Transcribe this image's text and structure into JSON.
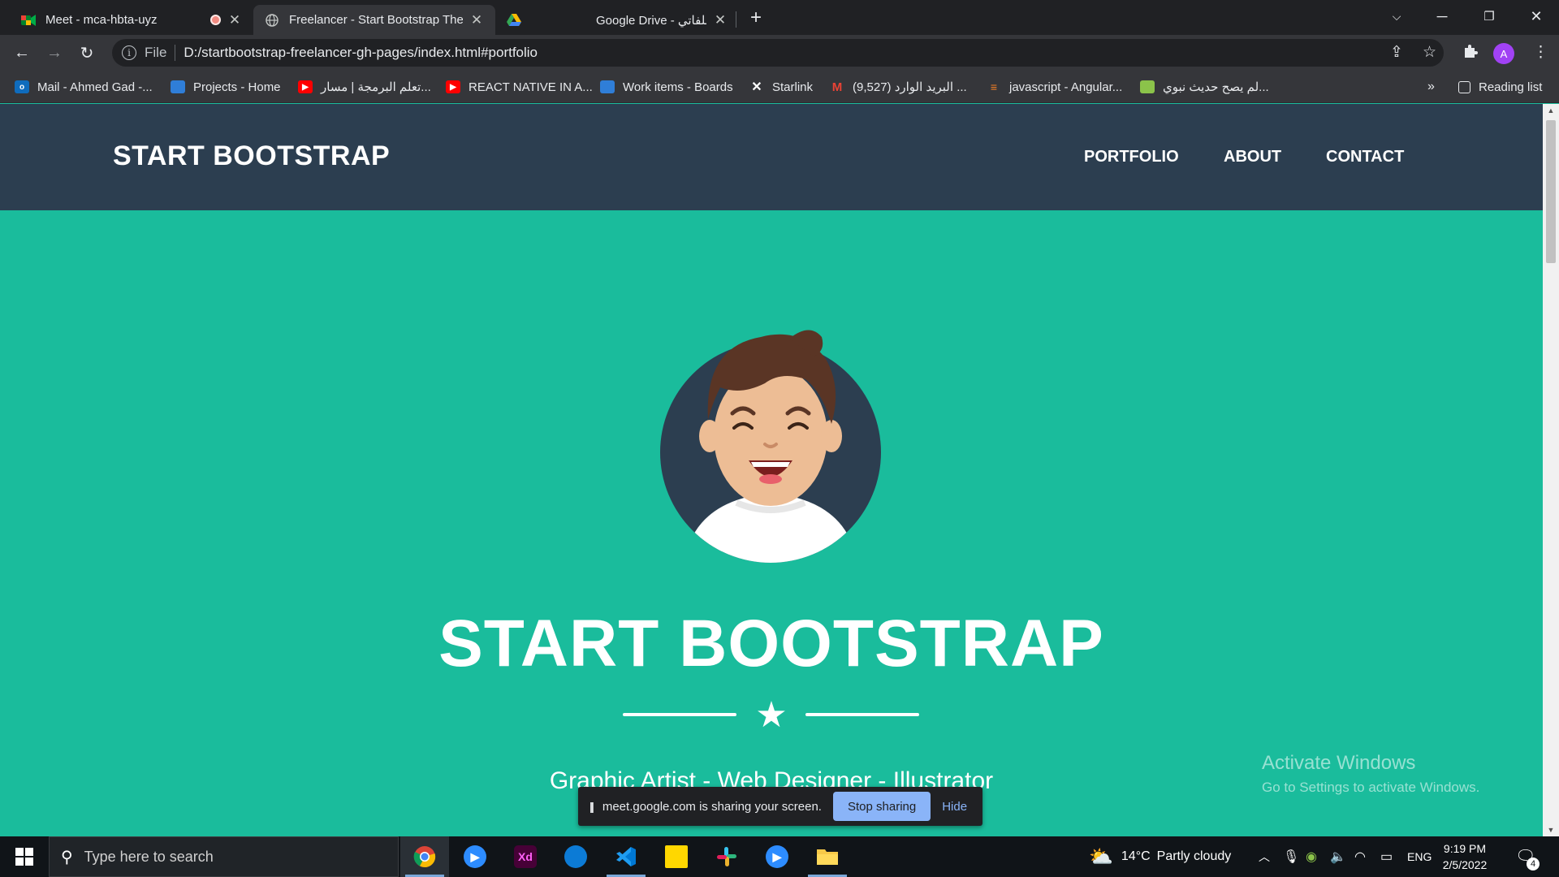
{
  "browser": {
    "tabs": [
      {
        "title": "Meet - mca-hbta-uyz",
        "favicon": "google-meet-icon"
      },
      {
        "title": "Freelancer - Start Bootstrap Theme",
        "favicon": "globe-icon"
      },
      {
        "title": "Google Drive - ملفاتي",
        "favicon": "google-drive-icon"
      }
    ],
    "address": {
      "scheme_label": "File",
      "url": "D:/startbootstrap-freelancer-gh-pages/index.html#portfolio"
    },
    "profile_initial": "A",
    "bookmarks": [
      {
        "label": "Mail - Ahmed Gad -...",
        "icon": "outlook-icon",
        "color": "#0f6cbd"
      },
      {
        "label": "Projects - Home",
        "icon": "azure-devops-icon",
        "color": "#2f7ed8"
      },
      {
        "label": "تعلم البرمجة | مسار...",
        "icon": "youtube-icon",
        "color": "#ff0000"
      },
      {
        "label": "REACT NATIVE IN A...",
        "icon": "youtube-icon",
        "color": "#ff0000"
      },
      {
        "label": "Work items - Boards",
        "icon": "azure-devops-icon",
        "color": "#2f7ed8"
      },
      {
        "label": "Starlink",
        "icon": "starlink-icon",
        "color": "#ffffff"
      },
      {
        "label": "(9,527) البريد الوارد ...",
        "icon": "gmail-icon",
        "color": "#ea4335"
      },
      {
        "label": "javascript - Angular...",
        "icon": "stackoverflow-icon",
        "color": "#f48024"
      },
      {
        "label": "لم يصح حديث نبوي...",
        "icon": "bookmark-site-icon",
        "color": "#8bc34a"
      }
    ],
    "bookmarks_overflow": "»",
    "reading_list": "Reading list"
  },
  "page": {
    "brand": "START BOOTSTRAP",
    "nav": [
      "PORTFOLIO",
      "ABOUT",
      "CONTACT"
    ],
    "hero_title": "START BOOTSTRAP",
    "hero_subtitle": "Graphic Artist - Web Designer - Illustrator",
    "colors": {
      "navbar": "#2c3e50",
      "hero": "#1abc9c"
    }
  },
  "watermark": {
    "line1": "Activate Windows",
    "line2": "Go to Settings to activate Windows."
  },
  "share_bar": {
    "message": "meet.google.com is sharing your screen.",
    "stop_label": "Stop sharing",
    "hide_label": "Hide"
  },
  "taskbar": {
    "search_placeholder": "Type here to search",
    "apps": [
      {
        "name": "chrome",
        "label": ""
      },
      {
        "name": "zoom",
        "label": ""
      },
      {
        "name": "adobe-xd",
        "label": "Xd"
      },
      {
        "name": "edge",
        "label": ""
      },
      {
        "name": "vscode",
        "label": ""
      },
      {
        "name": "sticky-notes",
        "label": ""
      },
      {
        "name": "slack",
        "label": ""
      },
      {
        "name": "zoom-meetings",
        "label": ""
      },
      {
        "name": "file-explorer",
        "label": ""
      }
    ],
    "weather": {
      "temp": "14°C",
      "condition": "Partly cloudy"
    },
    "language": "ENG",
    "time": "9:19 PM",
    "date": "2/5/2022",
    "notification_count": "4"
  }
}
